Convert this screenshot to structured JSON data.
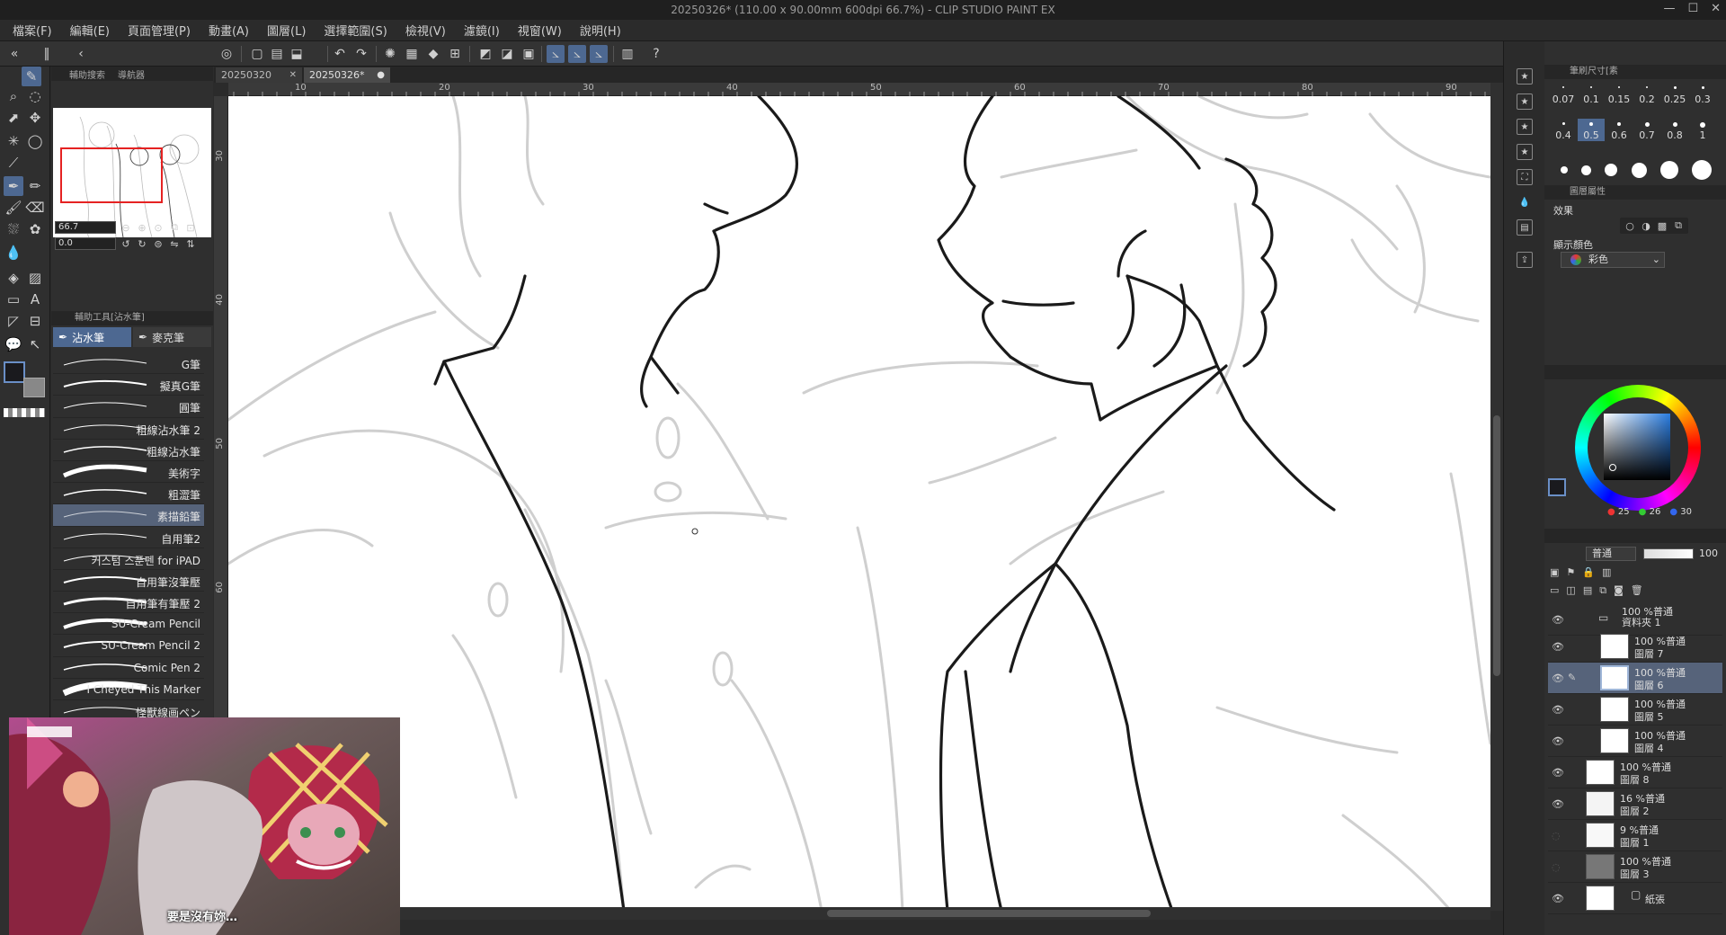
{
  "window": {
    "title": "20250326* (110.00 x 90.00mm 600dpi 66.7%)  - CLIP STUDIO PAINT EX"
  },
  "menu": [
    "檔案(F)",
    "編輯(E)",
    "頁面管理(P)",
    "動畫(A)",
    "圖層(L)",
    "選擇範圍(S)",
    "檢視(V)",
    "濾鏡(I)",
    "視窗(W)",
    "說明(H)"
  ],
  "left_panel": {
    "tabs": [
      "輔助搜索",
      "導航器"
    ],
    "zoom_value": "66.7",
    "rotate_value": "0.0",
    "subtool_header": "輔助工具[沾水筆]",
    "subtool_tabs": [
      "沾水筆",
      "麥克筆"
    ],
    "brushes": [
      "G筆",
      "擬真G筆",
      "圓筆",
      "粗線沾水筆 2",
      "粗線沾水筆",
      "美術字",
      "粗澀筆",
      "素描鉛筆",
      "自用筆2",
      "커스텀 스푼펜 for iPAD",
      "自用筆沒筆壓",
      "自用筆有筆壓 2",
      "SU-Cream Pencil",
      "SU-Cream Pencil 2",
      "Comic Pen 2",
      "I Cheyed This Marker",
      "怪獸線画ペン"
    ],
    "active_brush_index": 7
  },
  "doc_tabs": [
    {
      "label": "20250320",
      "active": false
    },
    {
      "label": "20250326*",
      "active": true
    }
  ],
  "rulers": {
    "top": [
      "10",
      "20",
      "30",
      "40",
      "50",
      "60",
      "70",
      "80",
      "90"
    ],
    "left": [
      "30",
      "40",
      "50",
      "60"
    ]
  },
  "video": {
    "subtitle": "要是沒有妳…"
  },
  "right_panel": {
    "brush_size_header": "筆刷尺寸[素",
    "brush_sizes": [
      "0.07",
      "0.1",
      "0.15",
      "0.2",
      "0.25",
      "0.3",
      "0.4",
      "0.5",
      "0.6",
      "0.7",
      "0.8",
      "1"
    ],
    "active_size": "0.5",
    "layer_prop_header": "圖層屬性",
    "effect_label": "效果",
    "display_color_label": "顯示顏色",
    "display_color_value": "彩色",
    "color_values": {
      "r": "25",
      "g": "26",
      "b": "30"
    },
    "blend_mode": "普通",
    "opacity": "100",
    "layers": [
      {
        "line1": "100 %普通",
        "line2": "資料夾 1",
        "folder": true,
        "indent": 0,
        "active": false
      },
      {
        "line1": "100 %普通",
        "line2": "圖層 7",
        "indent": 1,
        "active": false
      },
      {
        "line1": "100 %普通",
        "line2": "圖層 6",
        "indent": 1,
        "active": true
      },
      {
        "line1": "100 %普通",
        "line2": "圖層 5",
        "indent": 1,
        "active": false
      },
      {
        "line1": "100 %普通",
        "line2": "圖層 4",
        "indent": 1,
        "active": false
      },
      {
        "line1": "100 %普通",
        "line2": "圖層 8",
        "indent": 0,
        "active": false
      },
      {
        "line1": "16 %普通",
        "line2": "圖層 2",
        "indent": 0,
        "active": false
      },
      {
        "line1": "9 %普通",
        "line2": "圖層 1",
        "indent": 0,
        "active": false
      },
      {
        "line1": "100 %普通",
        "line2": "圖層 3",
        "indent": 0,
        "active": false
      },
      {
        "line1": "",
        "line2": "紙張",
        "indent": 0,
        "active": false
      }
    ]
  },
  "colors": {
    "accent": "#4d6891",
    "selected_row": "#56637a",
    "panel_bg": "#2f2f2f"
  }
}
